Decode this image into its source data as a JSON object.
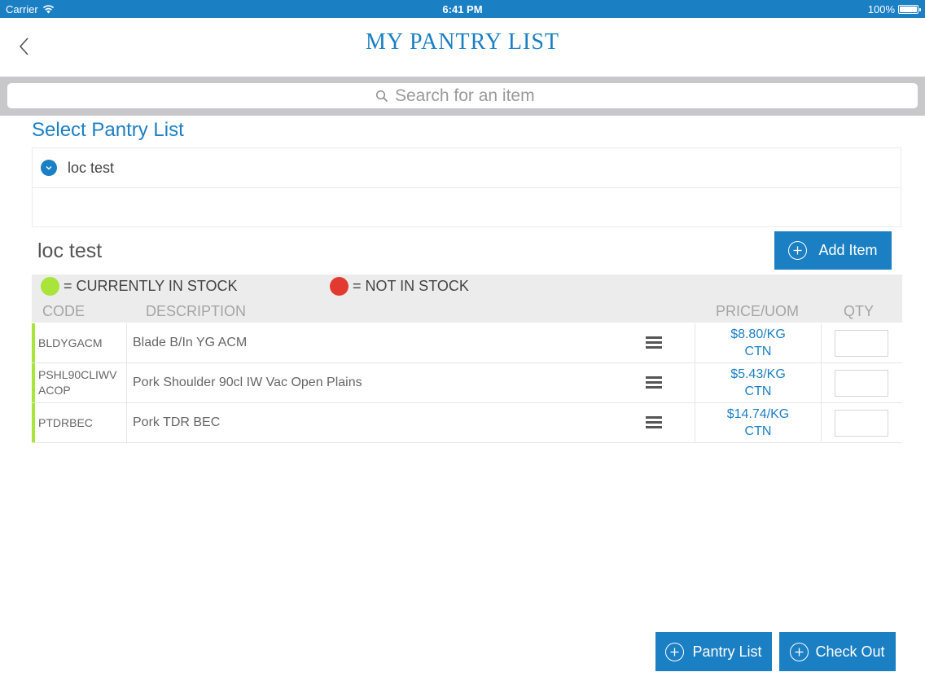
{
  "status_bar": {
    "carrier": "Carrier",
    "time": "6:41 PM",
    "battery": "100%"
  },
  "header": {
    "title": "MY PANTRY LIST"
  },
  "search": {
    "placeholder": "Search for an item"
  },
  "select_pantry": {
    "heading": "Select Pantry List",
    "options": [
      {
        "label": "loc test"
      }
    ]
  },
  "list": {
    "title": "loc test",
    "add_item_label": "Add Item",
    "legend": {
      "in_stock": {
        "label": "= CURRENTLY IN STOCK",
        "color": "#a8e43a"
      },
      "not_in_stock": {
        "label": "= NOT IN STOCK",
        "color": "#e23a30"
      }
    },
    "columns": {
      "code": "CODE",
      "description": "DESCRIPTION",
      "price": "PRICE/UOM",
      "qty": "QTY"
    },
    "rows": [
      {
        "code": "BLDYGACM",
        "description": "Blade B/In YG ACM",
        "price": "$8.80/KG",
        "uom": "CTN",
        "qty": "",
        "stock_color": "#a8e43a"
      },
      {
        "code": "PSHL90CLIWVACOP",
        "description": "Pork Shoulder 90cl IW Vac Open Plains",
        "price": "$5.43/KG",
        "uom": "CTN",
        "qty": "",
        "stock_color": "#a8e43a"
      },
      {
        "code": "PTDRBEC",
        "description": "Pork TDR BEC",
        "price": "$14.74/KG",
        "uom": "CTN",
        "qty": "",
        "stock_color": "#a8e43a"
      }
    ]
  },
  "footer": {
    "pantry_list_label": "Pantry List",
    "check_out_label": "Check Out"
  },
  "colors": {
    "brand": "#1b7fc4"
  },
  "icons": [
    "wifi-icon",
    "battery-icon",
    "back-chevron-icon",
    "search-icon",
    "chevron-down-icon",
    "plus-circle-icon",
    "menu-icon"
  ]
}
